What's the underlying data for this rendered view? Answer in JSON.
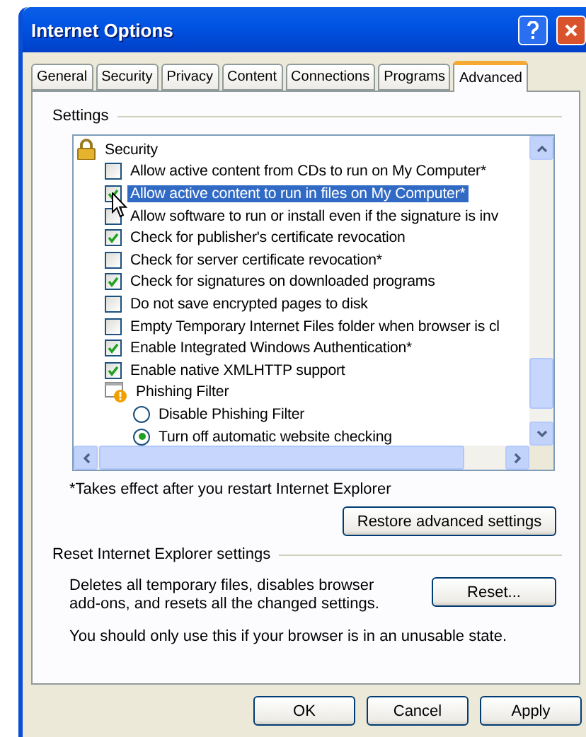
{
  "window": {
    "title": "Internet Options"
  },
  "tabs": [
    {
      "label": "General",
      "selected": false
    },
    {
      "label": "Security",
      "selected": false
    },
    {
      "label": "Privacy",
      "selected": false
    },
    {
      "label": "Content",
      "selected": false
    },
    {
      "label": "Connections",
      "selected": false
    },
    {
      "label": "Programs",
      "selected": false
    },
    {
      "label": "Advanced",
      "selected": true
    }
  ],
  "settings": {
    "legend": "Settings",
    "items": [
      {
        "kind": "group",
        "label": "Security",
        "selected": false,
        "children": [
          {
            "kind": "checkbox",
            "label": "Allow active content from CDs to run on My Computer*",
            "checked": false,
            "selected": false
          },
          {
            "kind": "checkbox",
            "label": "Allow active content to run in files on My Computer*",
            "checked": true,
            "selected": true
          },
          {
            "kind": "checkbox",
            "label": "Allow software to run or install even if the signature is inv",
            "checked": false,
            "selected": false
          },
          {
            "kind": "checkbox",
            "label": "Check for publisher's certificate revocation",
            "checked": true,
            "selected": false
          },
          {
            "kind": "checkbox",
            "label": "Check for server certificate revocation*",
            "checked": false,
            "selected": false
          },
          {
            "kind": "checkbox",
            "label": "Check for signatures on downloaded programs",
            "checked": true,
            "selected": false
          },
          {
            "kind": "checkbox",
            "label": "Do not save encrypted pages to disk",
            "checked": false,
            "selected": false
          },
          {
            "kind": "checkbox",
            "label": "Empty Temporary Internet Files folder when browser is cl",
            "checked": false,
            "selected": false
          },
          {
            "kind": "checkbox",
            "label": "Enable Integrated Windows Authentication*",
            "checked": true,
            "selected": false
          },
          {
            "kind": "checkbox",
            "label": "Enable native XMLHTTP support",
            "checked": true,
            "selected": false
          },
          {
            "kind": "group",
            "label": "Phishing Filter",
            "selected": false,
            "children": [
              {
                "kind": "radio",
                "label": "Disable Phishing Filter",
                "checked": false,
                "selected": false
              },
              {
                "kind": "radio",
                "label": "Turn off automatic website checking",
                "checked": true,
                "selected": false
              }
            ]
          }
        ]
      }
    ],
    "footnote": "*Takes effect after you restart Internet Explorer",
    "restore_button": "Restore advanced settings"
  },
  "reset": {
    "legend": "Reset Internet Explorer settings",
    "description": "Deletes all temporary files, disables browser add-ons, and resets all the changed settings.",
    "button": "Reset...",
    "warning": "You should only use this if your browser is in an unusable state."
  },
  "buttons": [
    "OK",
    "Cancel",
    "Apply"
  ]
}
